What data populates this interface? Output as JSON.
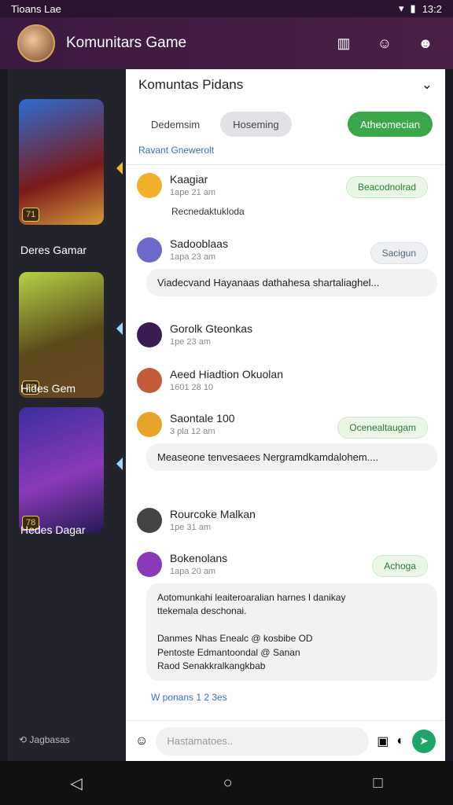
{
  "status": {
    "left": "Tioans Lae",
    "time": "13:2"
  },
  "header": {
    "title": "Komunitars Game"
  },
  "sidebar": {
    "games": [
      {
        "name": "Deres Gamar",
        "badge": "71"
      },
      {
        "name": "Hides Gem",
        "badge": "78"
      },
      {
        "name": "Hedes Dagar",
        "badge": "78"
      }
    ],
    "footer": "Jagbasas"
  },
  "chat": {
    "title": "Komuntas Pidans",
    "tabs": [
      "Dedemsim",
      "Hoseming"
    ],
    "cta": "Atheomecian",
    "subtitle": "Ravant Gnewerolt",
    "messages": [
      {
        "name": "Kaagiar",
        "time": "1ape 21 am",
        "pill": "Beacodnolrad",
        "text": "Recnedaktukloda"
      },
      {
        "name": "Sadooblaas",
        "time": "1apa 23 am",
        "pill": "Sacigun",
        "text": "Viadecvand Hayanaas dathahesa shartaliaghel..."
      },
      {
        "name": "Gorolk Gteonkas",
        "time": "1pe 23 am",
        "pill": "",
        "text": ""
      },
      {
        "name": "Aeed Hiadtion Okuolan",
        "time": "1601 28 10",
        "pill": "",
        "text": ""
      },
      {
        "name": "Saontale 100",
        "time": "3 pla 12 am",
        "pill": "Ocenealtaugam",
        "text": "Measeone tenvesaees Nergramdkamdalohem...."
      },
      {
        "name": "Rourcoke Malkan",
        "time": "1pe 31 am",
        "pill": "",
        "text": ""
      },
      {
        "name": "Bokenolans",
        "time": "1apa 20 am",
        "pill": "Achoga",
        "text": "Aotomunkahi leaiteroaralian harnes l danikay\nttekemala deschonai.\n\nDanmes Nhas Enealc @ kosbibe OD\nPentoste Edmantoondal @ Sanan\nRaod Senakkralkangkbab"
      }
    ],
    "footer": "W ponans 1 2 3es",
    "input_placeholder": "Hastamatoes.."
  }
}
